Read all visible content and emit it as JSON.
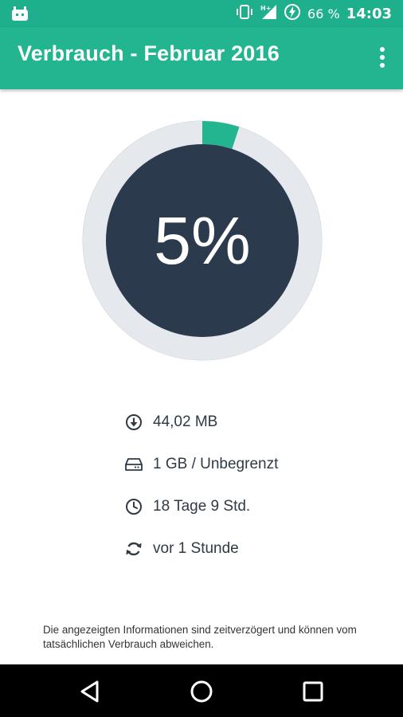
{
  "status_bar": {
    "battery_percent": "66 %",
    "time": "14:03",
    "icons": [
      "cyanogen-mascot-icon",
      "vibrate-icon",
      "signal-hplus-icon",
      "battery-charging-icon"
    ]
  },
  "app_bar": {
    "title": "Verbrauch - Februar 2016",
    "menu_icon": "more-vert-icon"
  },
  "usage": {
    "percent_label": "5%",
    "percent_value": 5,
    "colors": {
      "track": "#e5e9ee",
      "fill": "#22b590",
      "center": "#2c3a4e"
    }
  },
  "details": [
    {
      "icon": "download-icon",
      "text": "44,02 MB"
    },
    {
      "icon": "storage-icon",
      "text": "1 GB / Unbegrenzt"
    },
    {
      "icon": "clock-icon",
      "text": "18 Tage 9 Std."
    },
    {
      "icon": "sync-icon",
      "text": "vor 1 Stunde"
    }
  ],
  "disclaimer": "Die angezeigten Informationen sind zeitverzögert und können vom tatsächlichen Verbrauch abweichen.",
  "nav_bar": {
    "icons": [
      "back-icon",
      "home-icon",
      "recents-icon"
    ]
  }
}
